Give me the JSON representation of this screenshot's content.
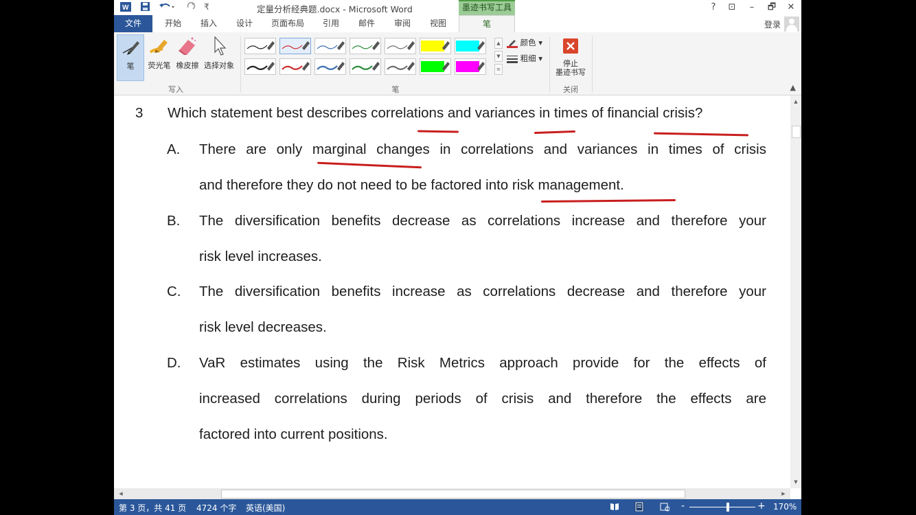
{
  "titlebar": {
    "title": "定量分析经典题.docx - Microsoft Word",
    "context_group": "墨迹书写工具",
    "help": "?",
    "restore_ribbon": "⊡",
    "minimize": "–",
    "maximize": "🗗",
    "close": "✕",
    "quick_access": {
      "customize": "₹"
    }
  },
  "tabs": {
    "file": "文件",
    "home": "开始",
    "insert": "插入",
    "design": "设计",
    "layout": "页面布局",
    "references": "引用",
    "mailings": "邮件",
    "review": "审阅",
    "view": "视图",
    "pen": "笔",
    "login": "登录"
  },
  "ribbon": {
    "write_group": {
      "label": "写入",
      "pen": "笔",
      "highlighter": "荧光笔",
      "eraser": "橡皮擦",
      "select": "选择对象"
    },
    "pens_group": {
      "label": "笔",
      "color": "颜色",
      "thickness": "粗细",
      "swatches_row1": [
        "#222222",
        "#d03030",
        "#3a6fb0",
        "#2e8b3a",
        "#707070",
        "#ffff00",
        "#00ffff"
      ],
      "swatches_row2": [
        "#222222",
        "#d03030",
        "#3a6fb0",
        "#2e8b3a",
        "#707070",
        "#00ff00",
        "#ff00ff"
      ]
    },
    "close_group": {
      "label": "关闭",
      "stop_line1": "停止",
      "stop_line2": "墨迹书写"
    }
  },
  "document": {
    "question_number": "3",
    "question_text": "Which statement best describes correlations and variances in times of financial crisis?",
    "options": [
      {
        "letter": "A.",
        "lines": [
          "There are only marginal changes in correlations and variances in times of crisis",
          "and therefore they do not need to be factored into risk management."
        ]
      },
      {
        "letter": "B.",
        "lines": [
          "The diversification benefits decrease as correlations increase and therefore your",
          "risk level increases."
        ]
      },
      {
        "letter": "C.",
        "lines": [
          "The diversification benefits increase as correlations decrease and therefore your",
          "risk level decreases."
        ]
      },
      {
        "letter": "D.",
        "lines": [
          "VaR estimates using the Risk Metrics approach provide for the effects of",
          "increased correlations during periods of crisis and therefore the effects are",
          "factored into current positions."
        ]
      }
    ]
  },
  "status": {
    "page": "第 3 页，共 41 页",
    "words": "4724 个字",
    "language": "英语(美国)",
    "zoom_minus": "-",
    "zoom_plus": "+",
    "zoom": "170%"
  },
  "colors": {
    "accent": "#2b579a",
    "ink": "#c81e1e",
    "context": "#9ccc96"
  }
}
